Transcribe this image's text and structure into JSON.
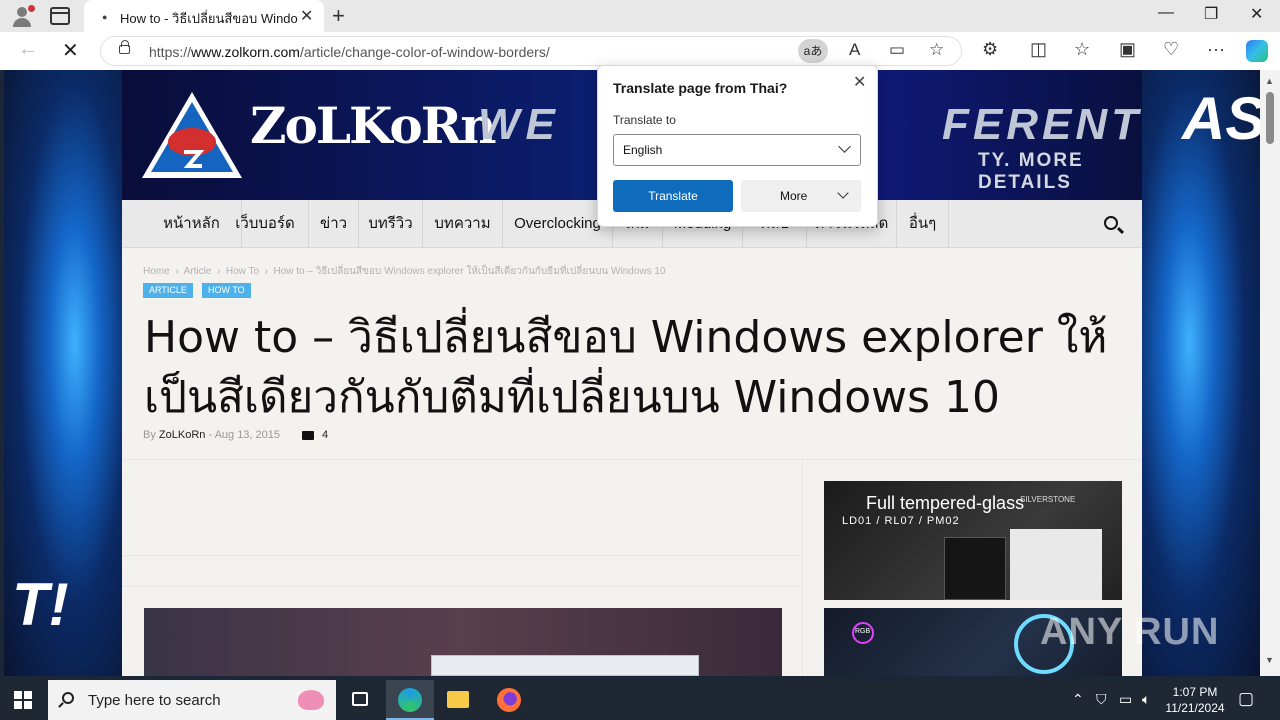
{
  "browser": {
    "tab_title": "How to - วิธีเปลี่ยนสีขอบ Windows explorer",
    "url_domain": "www.zolkorn.com",
    "url_prefix": "https://",
    "url_path": "/article/change-color-of-window-borders/",
    "translate_badge": "aあ"
  },
  "translate_popup": {
    "title": "Translate page from Thai?",
    "label": "Translate to",
    "selected_language": "English",
    "translate_button": "Translate",
    "more_button": "More"
  },
  "site": {
    "logo_text": "ZoLKoRn",
    "banner_slogan_left": "WE",
    "banner_slogan_right": "FERENT",
    "banner_subline": "TY. MORE DETAILS",
    "menu": [
      "หน้าหลัก",
      "เว็บบอร์ด",
      "ข่าว",
      "บทรีวิว",
      "บทความ",
      "Overclocking",
      "เกม",
      "Modding",
      "คลิป",
      "ดาวน์โหลด",
      "อื่นๆ"
    ],
    "background_text_left": "T!",
    "background_text_right": "ASR"
  },
  "article": {
    "breadcrumbs": [
      "Home",
      "Article",
      "How To",
      "How to – วิธีเปลี่ยนสีขอบ Windows explorer ให้เป็นสีเดียวกันกับธีมที่เปลี่ยนบน Windows 10"
    ],
    "categories": [
      "ARTICLE",
      "HOW TO"
    ],
    "title": "How to – วิธีเปลี่ยนสีขอบ Windows explorer ให้เป็นสีเดียวกันกับตีมที่เปลี่ยนบน Windows 10",
    "byline_prefix": "By",
    "author": "ZoLKoRn",
    "date": "Aug 13, 2015",
    "comments": "4"
  },
  "ads": {
    "ad1_title": "Full tempered-glass",
    "ad1_models": "LD01 / RL07 / PM02",
    "ad1_brand": "SILVERSTONE",
    "ad2_label": "RGB"
  },
  "watermark": "ANY RUN",
  "taskbar": {
    "search_placeholder": "Type here to search",
    "time": "1:07 PM",
    "date": "11/21/2024"
  },
  "colors": {
    "accent": "#0f6cbd",
    "category": "#4db2ec",
    "taskbar": "#1f2733"
  }
}
